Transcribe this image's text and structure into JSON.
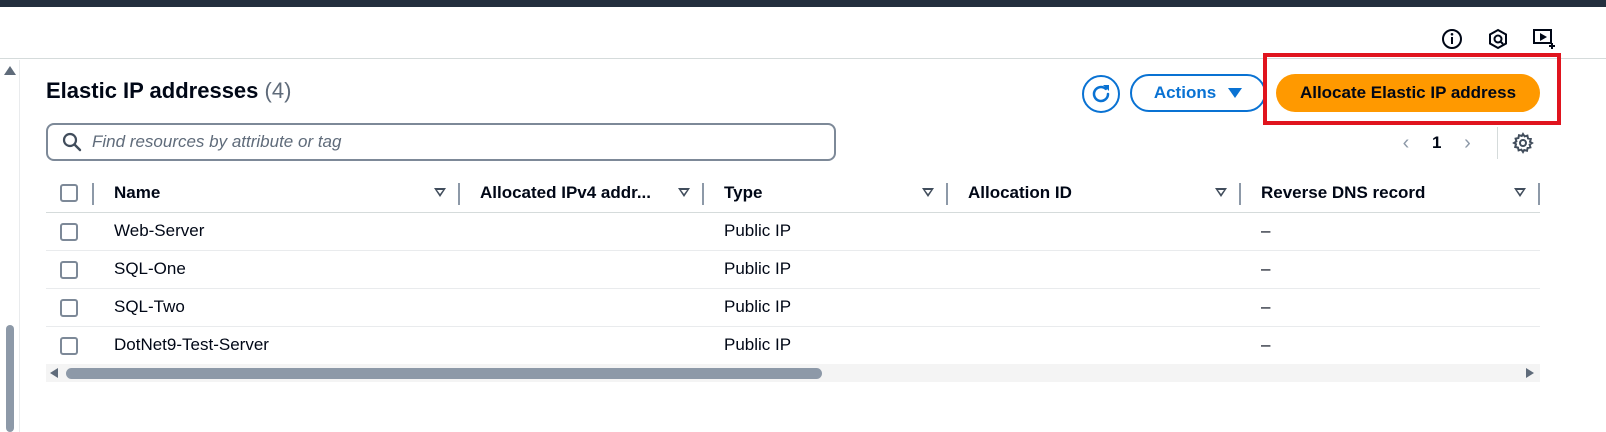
{
  "title": {
    "text": "Elastic IP addresses",
    "count": "(4)"
  },
  "toolbar": {
    "actions_label": "Actions",
    "allocate_label": "Allocate Elastic IP address"
  },
  "search": {
    "placeholder": "Find resources by attribute or tag"
  },
  "pagination": {
    "current_page": "1"
  },
  "table": {
    "columns": [
      "Name",
      "Allocated IPv4 addr...",
      "Type",
      "Allocation ID",
      "Reverse DNS record"
    ],
    "rows": [
      {
        "name": "Web-Server",
        "ipv4": "",
        "type": "Public IP",
        "allocation_id": "",
        "reverse_dns": "–"
      },
      {
        "name": "SQL-One",
        "ipv4": "",
        "type": "Public IP",
        "allocation_id": "",
        "reverse_dns": "–"
      },
      {
        "name": "SQL-Two",
        "ipv4": "",
        "type": "Public IP",
        "allocation_id": "",
        "reverse_dns": "–"
      },
      {
        "name": "DotNet9-Test-Server",
        "ipv4": "",
        "type": "Public IP",
        "allocation_id": "",
        "reverse_dns": "–"
      }
    ]
  },
  "icons": {
    "util": [
      "info-icon",
      "cloudshell-icon",
      "screen-share-icon"
    ],
    "refresh": "refresh-icon",
    "settings": "gear-icon",
    "search": "search-icon"
  },
  "colors": {
    "accent": "#0972d3",
    "primary_button": "#ff9900",
    "highlight": "#e0141e",
    "top_bar": "#232f3e"
  }
}
